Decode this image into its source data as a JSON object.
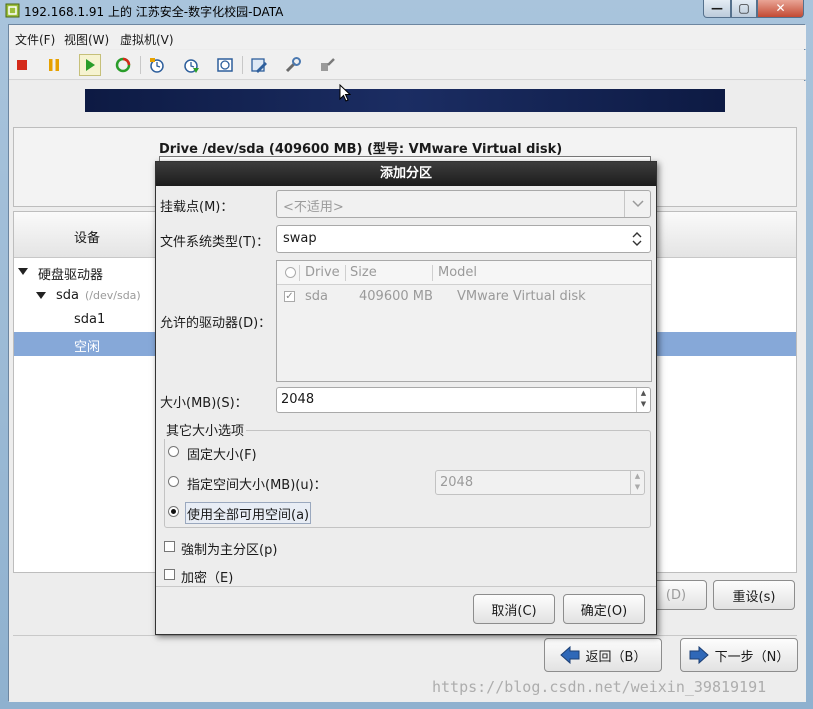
{
  "window": {
    "title": "192.168.1.91 上的 江苏安全-数字化校园-DATA",
    "min_glyph": "—",
    "max_glyph": "▢",
    "close_glyph": "✕"
  },
  "menubar": {
    "items": [
      "文件(F)",
      "视图(W)",
      "虚拟机(V)"
    ]
  },
  "toolbar": {
    "icons": [
      "stop-icon",
      "pause-icon",
      "play-icon",
      "reset-icon",
      "snapshot-icon",
      "revert-snapshot-icon",
      "manage-snapshots-icon",
      "edit-settings-icon",
      "vm-tools-icon",
      "connect-device-icon"
    ],
    "colors": {
      "stop": "#d42a1a",
      "pause": "#e6a100",
      "play": "#2a9d2a"
    }
  },
  "installer": {
    "drive_label": "Drive /dev/sda (409600 MB) (型号: VMware Virtual disk)",
    "tree_header": "设备",
    "tree": [
      {
        "label": "硬盘驱动器",
        "sub": ""
      },
      {
        "label": "sda",
        "sub": "(/dev/sda)"
      },
      {
        "label": "sda1",
        "sub": ""
      },
      {
        "label": "空闲",
        "sub": ""
      }
    ],
    "delete_button": "(D)",
    "reset_button": "重设(s)",
    "back_button": "返回（B）",
    "next_button": "下一步（N）",
    "banner_color": "#13224f",
    "selected_color": "#86a8d8"
  },
  "dialog": {
    "title": "添加分区",
    "mount_label": "挂载点(M)：",
    "mount_placeholder": "<不适用>",
    "fstype_label": "文件系统类型(T)：",
    "fstype_value": "swap",
    "drives_label": "允许的驱动器(D)：",
    "drive_columns": [
      "Drive",
      "Size",
      "Model"
    ],
    "drive_rows": [
      {
        "drive": "sda",
        "size": "409600 MB",
        "model": "VMware Virtual disk",
        "checked": true
      }
    ],
    "size_label": "大小(MB)(S)：",
    "size_value": "2048",
    "other_size_title": "其它大小选项",
    "opt_fixed": "固定大小(F)",
    "opt_up_to": "指定空间大小(MB)(u)：",
    "opt_up_to_value": "2048",
    "opt_fill": "使用全部可用空间(a)",
    "selected_option": "fill",
    "force_primary": "強制为主分区(p)",
    "encrypt": "加密（E)",
    "cancel_button": "取消(C)",
    "ok_button": "确定(O)"
  },
  "watermark": "https://blog.csdn.net/weixin_39819191"
}
